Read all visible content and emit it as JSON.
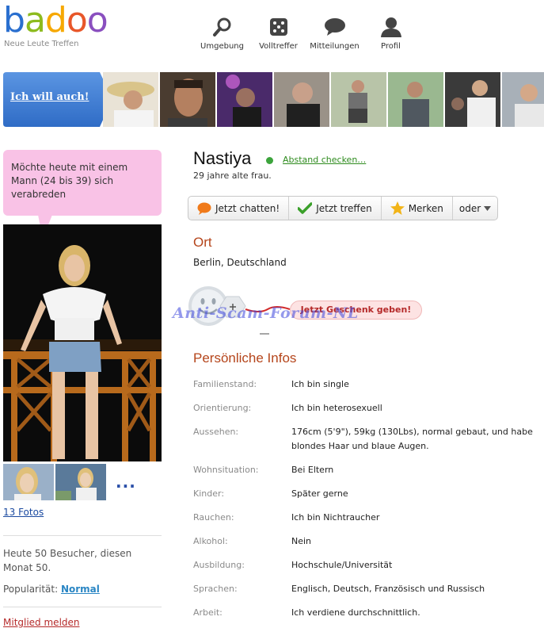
{
  "brand": {
    "logo_text": "badoo",
    "tagline": "Neue Leute Treffen"
  },
  "nav": {
    "items": [
      {
        "label": "Umgebung",
        "icon": "search-icon"
      },
      {
        "label": "Volltreffer",
        "icon": "dice-icon"
      },
      {
        "label": "Mitteilungen",
        "icon": "speech-bubble-icon"
      },
      {
        "label": "Profil",
        "icon": "person-icon"
      }
    ]
  },
  "promo": {
    "button_label": "Ich will auch!",
    "thumb_count": 8
  },
  "left": {
    "bubble_text": "Möchte heute mit einem Mann (24 bis 39) sich verabreden",
    "more_photos": "...",
    "photos_link": "13 Fotos",
    "visitors": "Heute 50 Besucher, diesen Monat 50.",
    "popularity_label": "Popularität:",
    "popularity_value": "Normal",
    "report_link": "Mitglied melden"
  },
  "profile": {
    "name": "Nastiya",
    "distance_link": "Abstand checken…",
    "age_line": "29 jahre alte frau.",
    "actions": {
      "chat": "Jetzt chatten!",
      "meet": "Jetzt treffen",
      "save": "Merken",
      "more": "oder"
    },
    "location_title": "Ort",
    "location": "Berlin, Deutschland",
    "gift_button": "Jetzt Geschenk geben!",
    "watermark": "Anti-Scam-Forum-NL",
    "info_title": "Persönliche Infos",
    "info": [
      {
        "label": "Familienstand:",
        "value": "Ich bin single"
      },
      {
        "label": "Orientierung:",
        "value": "Ich bin heterosexuell"
      },
      {
        "label": "Aussehen:",
        "value": "176cm (5'9\"), 59kg (130Lbs), normal gebaut, und habe blondes Haar und blaue Augen."
      },
      {
        "label": "Wohnsituation:",
        "value": "Bei Eltern"
      },
      {
        "label": "Kinder:",
        "value": "Später gerne"
      },
      {
        "label": "Rauchen:",
        "value": "Ich bin Nichtraucher"
      },
      {
        "label": "Alkohol:",
        "value": "Nein"
      },
      {
        "label": "Ausbildung:",
        "value": "Hochschule/Universität"
      },
      {
        "label": "Sprachen:",
        "value": "Englisch, Deutsch, Französisch und Russisch"
      },
      {
        "label": "Arbeit:",
        "value": "Ich verdiene durchschnittlich."
      }
    ]
  },
  "colors": {
    "accent_orange": "#b5451b",
    "bubble_pink": "#f9c2e6",
    "promo_blue": "#3f7fd8",
    "online_green": "#3ca43c"
  }
}
